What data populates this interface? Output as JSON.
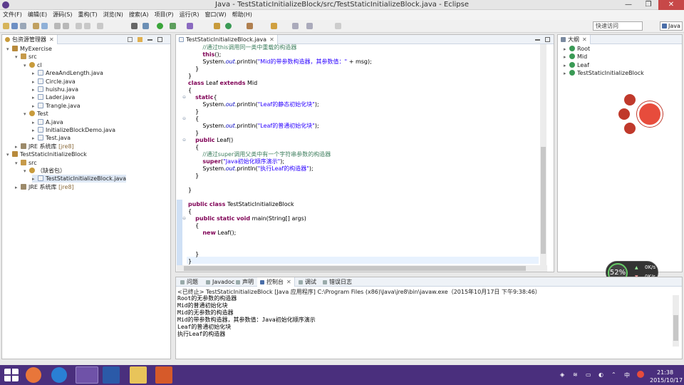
{
  "window": {
    "title": "Java - TestStaticInitializeBlock/src/TestStaticInitializeBlock.java - Eclipse",
    "minimize": "—",
    "maximize": "❐",
    "close": "✕"
  },
  "menu": [
    "文件(F)",
    "编辑(E)",
    "源码(S)",
    "重构(T)",
    "浏览(N)",
    "搜索(A)",
    "项目(P)",
    "运行(R)",
    "窗口(W)",
    "帮助(H)"
  ],
  "quick_access": {
    "placeholder": "快速访问"
  },
  "perspective": {
    "label": "Java"
  },
  "package_explorer": {
    "tab": "包资源管理器",
    "tab_close": "✕",
    "tree": [
      {
        "label": "MyExercise",
        "depth": 0,
        "icon": "project-icon",
        "twisty": "▾"
      },
      {
        "label": "src",
        "depth": 1,
        "icon": "source-folder-icon",
        "twisty": "▾"
      },
      {
        "label": "cl",
        "depth": 2,
        "icon": "package-icon",
        "twisty": "▾"
      },
      {
        "label": "AreaAndLength.java",
        "depth": 3,
        "icon": "java-file-icon",
        "twisty": "▸"
      },
      {
        "label": "Circle.java",
        "depth": 3,
        "icon": "java-file-icon",
        "twisty": "▸"
      },
      {
        "label": "huishu.java",
        "depth": 3,
        "icon": "java-file-icon",
        "twisty": "▸"
      },
      {
        "label": "Lader.java",
        "depth": 3,
        "icon": "java-file-icon",
        "twisty": "▸"
      },
      {
        "label": "Trangle.java",
        "depth": 3,
        "icon": "java-file-icon",
        "twisty": "▸"
      },
      {
        "label": "Test",
        "depth": 2,
        "icon": "package-icon",
        "twisty": "▾"
      },
      {
        "label": "A.java",
        "depth": 3,
        "icon": "java-file-icon",
        "twisty": "▸"
      },
      {
        "label": "InitializeBlockDemo.java",
        "depth": 3,
        "icon": "java-file-icon",
        "twisty": "▸"
      },
      {
        "label": "Test.java",
        "depth": 3,
        "icon": "java-file-icon",
        "twisty": "▸"
      },
      {
        "label": "JRE 系统库",
        "suffix": "[jre8]",
        "depth": 1,
        "icon": "library-icon",
        "twisty": "▸"
      },
      {
        "label": "TestStaticInitializeBlock",
        "depth": 0,
        "icon": "project-icon",
        "twisty": "▾"
      },
      {
        "label": "src",
        "depth": 1,
        "icon": "source-folder-icon",
        "twisty": "▾"
      },
      {
        "label": "（缺省包）",
        "depth": 2,
        "icon": "package-icon",
        "twisty": "▾"
      },
      {
        "label": "TestStaticInitializeBlock.java",
        "depth": 3,
        "icon": "java-file-icon",
        "twisty": "▸",
        "selected": true
      },
      {
        "label": "JRE 系统库",
        "suffix": "[jre8]",
        "depth": 1,
        "icon": "library-icon",
        "twisty": "▸"
      }
    ]
  },
  "editor": {
    "tab": "TestStaticInitializeBlock.java",
    "tab_close": "✕",
    "lines": [
      [
        [
          "",
          "        "
        ],
        [
          "cm",
          "//通过this调用同一类中重载的构造器"
        ]
      ],
      [
        [
          "",
          "        "
        ],
        [
          "kw",
          "this"
        ],
        [
          "",
          "();"
        ]
      ],
      [
        [
          "",
          "        System."
        ],
        [
          "fd",
          "out"
        ],
        [
          "",
          ".println("
        ],
        [
          "st",
          "\"Mid的带参数构造器，其参数值：\""
        ],
        [
          "",
          " + msg);"
        ]
      ],
      [
        [
          "",
          "    }"
        ]
      ],
      [
        [
          "",
          "}"
        ]
      ],
      [
        [
          "kw",
          "class"
        ],
        [
          "",
          " Leaf "
        ],
        [
          "kw",
          "extends"
        ],
        [
          "",
          " Mid"
        ]
      ],
      [
        [
          "",
          "{"
        ]
      ],
      [
        [
          "",
          "    "
        ],
        [
          "kw",
          "static"
        ],
        [
          "",
          "{"
        ]
      ],
      [
        [
          "",
          "        System."
        ],
        [
          "fd",
          "out"
        ],
        [
          "",
          ".println("
        ],
        [
          "st",
          "\"Leaf的静态初始化块\""
        ],
        [
          "",
          ");"
        ]
      ],
      [
        [
          "",
          "    }"
        ]
      ],
      [
        [
          "",
          "    {"
        ]
      ],
      [
        [
          "",
          "        System."
        ],
        [
          "fd",
          "out"
        ],
        [
          "",
          ".println("
        ],
        [
          "st",
          "\"Leaf的普通初始化块\""
        ],
        [
          "",
          ");"
        ]
      ],
      [
        [
          "",
          "    }"
        ]
      ],
      [
        [
          "",
          "    "
        ],
        [
          "kw",
          "public"
        ],
        [
          "",
          " Leaf()"
        ]
      ],
      [
        [
          "",
          "    {"
        ]
      ],
      [
        [
          "",
          "        "
        ],
        [
          "cm",
          "//通过super调用父类中有一个字符串参数的构造器"
        ]
      ],
      [
        [
          "",
          "        "
        ],
        [
          "kw",
          "super"
        ],
        [
          "",
          "("
        ],
        [
          "st",
          "\"Java初始化顺序演示\""
        ],
        [
          "",
          ");"
        ]
      ],
      [
        [
          "",
          "        System."
        ],
        [
          "fd",
          "out"
        ],
        [
          "",
          ".println("
        ],
        [
          "st",
          "\"执行Leaf的构造器\""
        ],
        [
          "",
          ");"
        ]
      ],
      [
        [
          "",
          "    }"
        ]
      ],
      [
        [
          "",
          ""
        ]
      ],
      [
        [
          "",
          "}"
        ]
      ],
      [
        [
          "",
          ""
        ]
      ],
      [
        [
          "kw",
          "public"
        ],
        [
          "",
          " "
        ],
        [
          "kw",
          "class"
        ],
        [
          "",
          " TestStaticInitializeBlock"
        ]
      ],
      [
        [
          "",
          "{"
        ]
      ],
      [
        [
          "",
          "    "
        ],
        [
          "kw",
          "public"
        ],
        [
          "",
          " "
        ],
        [
          "kw",
          "static"
        ],
        [
          "",
          " "
        ],
        [
          "kw",
          "void"
        ],
        [
          "",
          " main(String[] args)"
        ]
      ],
      [
        [
          "",
          "    {"
        ]
      ],
      [
        [
          "",
          "        "
        ],
        [
          "kw",
          "new"
        ],
        [
          "",
          " Leaf();"
        ]
      ],
      [
        [
          "",
          ""
        ]
      ],
      [
        [
          "",
          ""
        ]
      ],
      [
        [
          "",
          "    }"
        ]
      ],
      [
        [
          "",
          "}"
        ]
      ]
    ]
  },
  "outline": {
    "tab": "大纲",
    "tab_close": "✕",
    "items": [
      "Root",
      "Mid",
      "Leaf",
      "TestStaticInitializeBlock"
    ]
  },
  "bottom_tabs": [
    "问题",
    "Javadoc",
    "声明",
    "控制台",
    "调试",
    "错误日志"
  ],
  "bottom_tab_close": "✕",
  "console": {
    "header": "<已终止> TestStaticInitializeBlock [Java 应用程序] C:\\Program Files (x86)\\Java\\jre8\\bin\\javaw.exe（2015年10月17日 下午9:38:46）",
    "lines": [
      "Root的无参数的构造器",
      "Mid的普通初始化块",
      "Mid的无参数的构造器",
      "Mid的带参数构造器，其参数值：Java初始化顺序演示",
      "Leaf的普通初始化块",
      "执行Leaf的构造器"
    ]
  },
  "widget": {
    "percent": "52%",
    "up": "0K/s",
    "down": "0K/s"
  },
  "taskbar": {
    "time": "21:38",
    "date": "2015/10/17",
    "ime": "中"
  },
  "colors": {
    "taskbar": "#4a2f7d",
    "keyword": "#7f0055",
    "comment": "#3f7f5f",
    "string": "#2a00ff"
  }
}
